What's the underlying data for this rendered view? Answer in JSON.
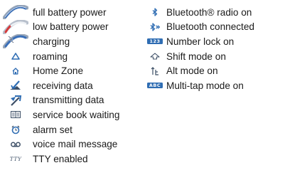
{
  "left_column": {
    "items": [
      {
        "icon": "battery-full-icon",
        "label": "full battery power"
      },
      {
        "icon": "battery-low-icon",
        "label": "low battery power"
      },
      {
        "icon": "battery-charging-icon",
        "label": "charging"
      },
      {
        "icon": "roaming-icon",
        "label": "roaming"
      },
      {
        "icon": "home-zone-icon",
        "label": "Home Zone"
      },
      {
        "icon": "receiving-data-icon",
        "label": "receiving data"
      },
      {
        "icon": "transmitting-data-icon",
        "label": "transmitting data"
      },
      {
        "icon": "service-book-icon",
        "label": "service book waiting"
      },
      {
        "icon": "alarm-icon",
        "label": "alarm set"
      },
      {
        "icon": "voicemail-icon",
        "label": "voice mail message"
      },
      {
        "icon": "tty-icon",
        "label": "TTY enabled"
      }
    ]
  },
  "right_column": {
    "items": [
      {
        "icon": "bluetooth-icon",
        "label": "Bluetooth® radio on"
      },
      {
        "icon": "bluetooth-connected-icon",
        "label": "Bluetooth connected"
      },
      {
        "icon": "number-lock-icon",
        "label": "Number lock on"
      },
      {
        "icon": "shift-icon",
        "label": "Shift mode on"
      },
      {
        "icon": "alt-icon",
        "label": "Alt mode on"
      },
      {
        "icon": "multitap-icon",
        "label": "Multi-tap mode on"
      }
    ]
  },
  "icon_texts": {
    "number_lock": "123",
    "multitap": "ABC",
    "tty": "TTY"
  },
  "colors": {
    "battery_full_fill": "#3a6fb8",
    "battery_low_fill": "#d63a3a",
    "battery_charging_fill": "#3a6fb8",
    "icon_blue": "#2f6db3",
    "icon_dark": "#3d4f66",
    "text": "#1a1a1a"
  }
}
